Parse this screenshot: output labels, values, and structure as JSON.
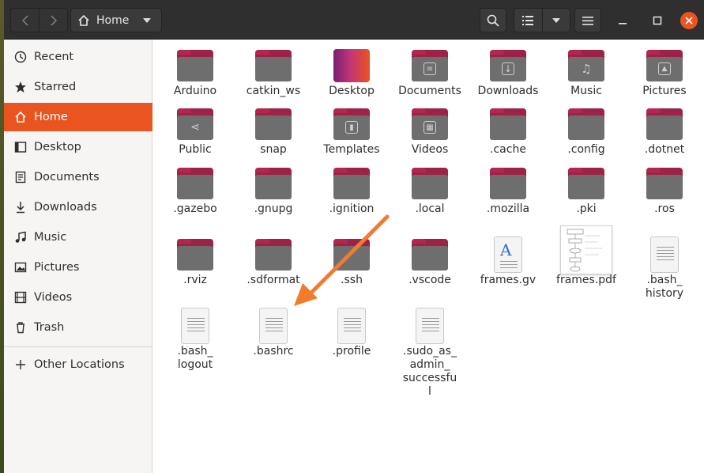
{
  "header": {
    "path_label": "Home"
  },
  "sidebar": {
    "items": [
      {
        "label": "Recent",
        "icon": "clock-icon"
      },
      {
        "label": "Starred",
        "icon": "star-icon"
      },
      {
        "label": "Home",
        "icon": "home-icon"
      },
      {
        "label": "Desktop",
        "icon": "desktop-icon"
      },
      {
        "label": "Documents",
        "icon": "document-icon"
      },
      {
        "label": "Downloads",
        "icon": "download-icon"
      },
      {
        "label": "Music",
        "icon": "music-icon"
      },
      {
        "label": "Pictures",
        "icon": "pictures-icon"
      },
      {
        "label": "Videos",
        "icon": "video-icon"
      },
      {
        "label": "Trash",
        "icon": "trash-icon"
      }
    ],
    "other_locations": "Other Locations"
  },
  "files": [
    {
      "name": "Arduino",
      "kind": "folder"
    },
    {
      "name": "catkin_ws",
      "kind": "folder"
    },
    {
      "name": "Desktop",
      "kind": "desktop"
    },
    {
      "name": "Documents",
      "kind": "folder-documents"
    },
    {
      "name": "Downloads",
      "kind": "folder-downloads"
    },
    {
      "name": "Music",
      "kind": "folder-music"
    },
    {
      "name": "Pictures",
      "kind": "folder-pictures"
    },
    {
      "name": "Public",
      "kind": "folder-public"
    },
    {
      "name": "snap",
      "kind": "folder"
    },
    {
      "name": "Templates",
      "kind": "folder-templates"
    },
    {
      "name": "Videos",
      "kind": "folder-videos"
    },
    {
      "name": ".cache",
      "kind": "folder"
    },
    {
      "name": ".config",
      "kind": "folder"
    },
    {
      "name": ".dotnet",
      "kind": "folder"
    },
    {
      "name": ".gazebo",
      "kind": "folder"
    },
    {
      "name": ".gnupg",
      "kind": "folder"
    },
    {
      "name": ".ignition",
      "kind": "folder"
    },
    {
      "name": ".local",
      "kind": "folder"
    },
    {
      "name": ".mozilla",
      "kind": "folder"
    },
    {
      "name": ".pki",
      "kind": "folder"
    },
    {
      "name": ".ros",
      "kind": "folder"
    },
    {
      "name": ".rviz",
      "kind": "folder"
    },
    {
      "name": ".sdformat",
      "kind": "folder"
    },
    {
      "name": ".ssh",
      "kind": "folder"
    },
    {
      "name": ".vscode",
      "kind": "folder"
    },
    {
      "name": "frames.gv",
      "kind": "text-gv"
    },
    {
      "name": "frames.pdf",
      "kind": "pdf"
    },
    {
      "name": ".bash_ history",
      "kind": "text"
    },
    {
      "name": ".bash_ logout",
      "kind": "text"
    },
    {
      "name": ".bashrc",
      "kind": "text"
    },
    {
      "name": ".profile",
      "kind": "text"
    },
    {
      "name": ".sudo_as_ admin_ successful",
      "kind": "text"
    }
  ],
  "colors": {
    "accent": "#e95420",
    "folder_tab": "#9c2248",
    "folder_body": "#6e6e6e",
    "annotation_arrow": "#f07c2c"
  }
}
